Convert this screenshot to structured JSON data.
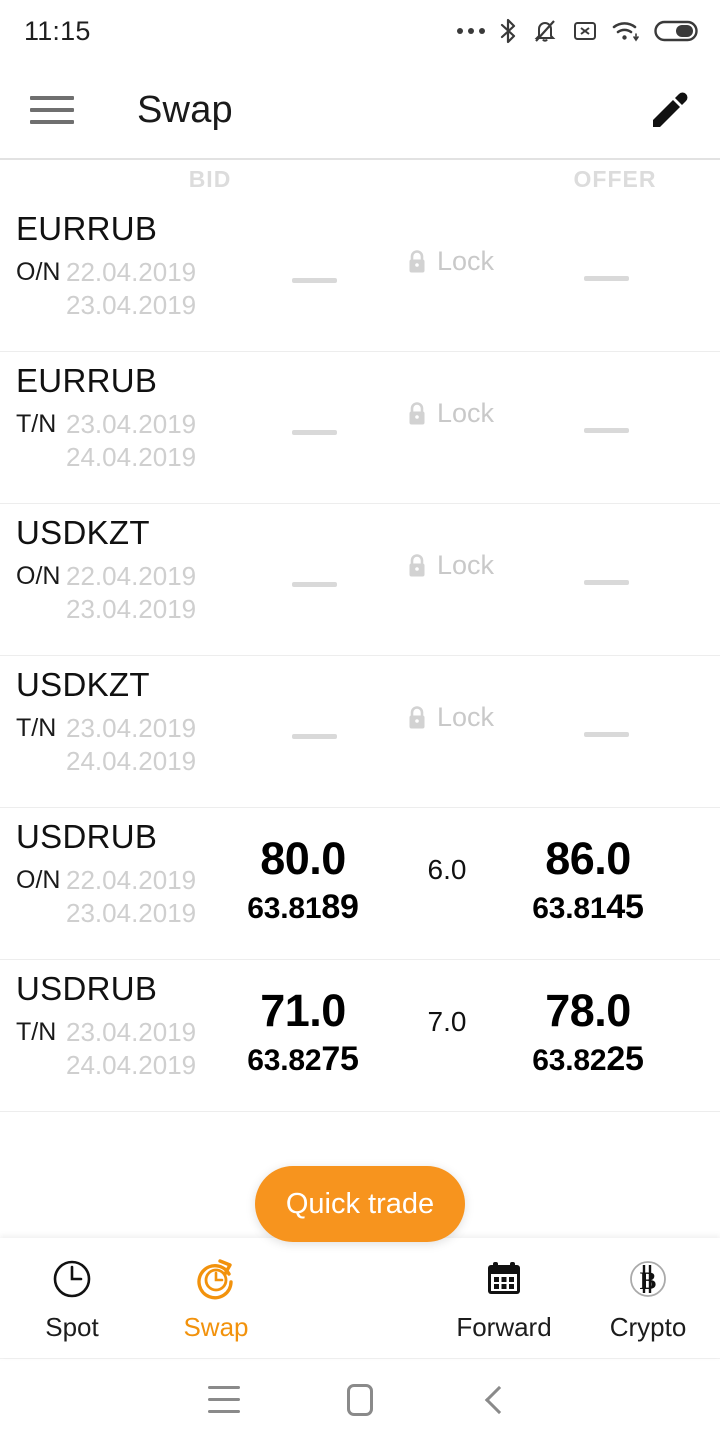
{
  "status_bar": {
    "time": "11:15",
    "icons": [
      "more-dots-icon",
      "bluetooth-icon",
      "bell-muted-icon",
      "sim-card-x-icon",
      "wifi-icon",
      "battery-icon"
    ]
  },
  "app_bar": {
    "menu_icon": "hamburger-menu-icon",
    "title": "Swap",
    "edit_icon": "pencil-edit-icon"
  },
  "columns": {
    "bid": "BID",
    "offer": "OFFER"
  },
  "lock": {
    "label": "Lock",
    "icon": "padlock-icon"
  },
  "empty_value": "—",
  "rows": [
    {
      "pair": "EURRUB",
      "tenor": "O/N",
      "date_from": "22.04.2019",
      "date_to": "23.04.2019",
      "has_quote": false,
      "locked": true,
      "bid_points": "",
      "bid_rate_base": "",
      "bid_rate_pips": "",
      "spread": "",
      "offer_points": "",
      "offer_rate_base": "",
      "offer_rate_pips": ""
    },
    {
      "pair": "EURRUB",
      "tenor": "T/N",
      "date_from": "23.04.2019",
      "date_to": "24.04.2019",
      "has_quote": false,
      "locked": true,
      "bid_points": "",
      "bid_rate_base": "",
      "bid_rate_pips": "",
      "spread": "",
      "offer_points": "",
      "offer_rate_base": "",
      "offer_rate_pips": ""
    },
    {
      "pair": "USDKZT",
      "tenor": "O/N",
      "date_from": "22.04.2019",
      "date_to": "23.04.2019",
      "has_quote": false,
      "locked": true,
      "bid_points": "",
      "bid_rate_base": "",
      "bid_rate_pips": "",
      "spread": "",
      "offer_points": "",
      "offer_rate_base": "",
      "offer_rate_pips": ""
    },
    {
      "pair": "USDKZT",
      "tenor": "T/N",
      "date_from": "23.04.2019",
      "date_to": "24.04.2019",
      "has_quote": false,
      "locked": true,
      "bid_points": "",
      "bid_rate_base": "",
      "bid_rate_pips": "",
      "spread": "",
      "offer_points": "",
      "offer_rate_base": "",
      "offer_rate_pips": ""
    },
    {
      "pair": "USDRUB",
      "tenor": "O/N",
      "date_from": "22.04.2019",
      "date_to": "23.04.2019",
      "has_quote": true,
      "locked": false,
      "bid_points": "80.0",
      "bid_rate_base": "63.81",
      "bid_rate_pips": "89",
      "spread": "6.0",
      "offer_points": "86.0",
      "offer_rate_base": "63.81",
      "offer_rate_pips": "45"
    },
    {
      "pair": "USDRUB",
      "tenor": "T/N",
      "date_from": "23.04.2019",
      "date_to": "24.04.2019",
      "has_quote": true,
      "locked": false,
      "bid_points": "71.0",
      "bid_rate_base": "63.82",
      "bid_rate_pips": "75",
      "spread": "7.0",
      "offer_points": "78.0",
      "offer_rate_base": "63.82",
      "offer_rate_pips": "25"
    }
  ],
  "quick_trade": {
    "label": "Quick trade",
    "color": "#F7941E"
  },
  "bottom_nav": {
    "active": "Swap",
    "accent_color": "#F2920C",
    "items": [
      {
        "label": "Spot",
        "icon": "clock-icon"
      },
      {
        "label": "Swap",
        "icon": "clock-refresh-icon"
      },
      {
        "label": "Forward",
        "icon": "calendar-icon"
      },
      {
        "label": "Crypto",
        "icon": "bitcoin-icon"
      }
    ]
  },
  "system_nav": {
    "recents": "recents-icon",
    "home": "home-icon",
    "back": "back-icon"
  }
}
